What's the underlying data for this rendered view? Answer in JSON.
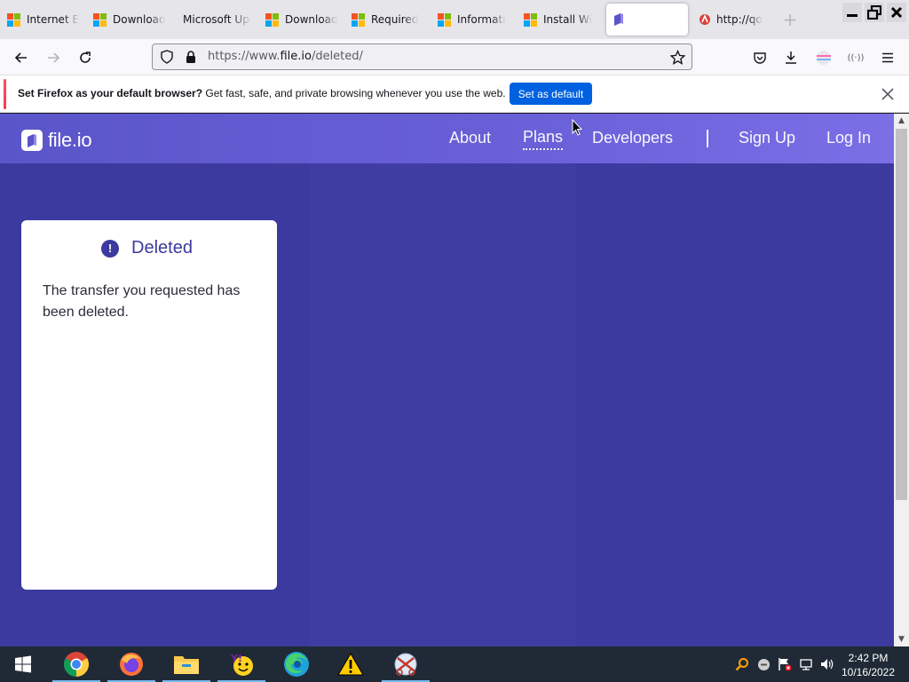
{
  "browser": {
    "tabs": [
      {
        "title": "Internet E",
        "favicon": "microsoft-icon",
        "active": false
      },
      {
        "title": "Download",
        "favicon": "microsoft-icon",
        "active": false
      },
      {
        "title": "Microsoft Upo",
        "favicon": "none",
        "active": false
      },
      {
        "title": "Download",
        "favicon": "microsoft-icon",
        "active": false
      },
      {
        "title": "Required",
        "favicon": "microsoft-icon",
        "active": false
      },
      {
        "title": "Informati",
        "favicon": "microsoft-icon",
        "active": false
      },
      {
        "title": "Install Wi",
        "favicon": "microsoft-icon",
        "active": false
      },
      {
        "title": "",
        "favicon": "fileio-icon",
        "active": true
      },
      {
        "title": "http://qo",
        "favicon": "http-icon",
        "active": false
      }
    ],
    "url_prefix": "https://www.",
    "url_domain": "file.io",
    "url_path": "/deleted/",
    "notification": {
      "bold": "Set Firefox as your default browser?",
      "text": " Get fast, safe, and private browsing whenever you use the web.",
      "button": "Set as default"
    }
  },
  "site": {
    "logo_text": "file.io",
    "nav": {
      "about": "About",
      "plans": "Plans",
      "developers": "Developers",
      "signup": "Sign Up",
      "login": "Log In"
    },
    "card": {
      "icon": "!",
      "title": "Deleted",
      "body": "The transfer you requested has been deleted."
    }
  },
  "taskbar": {
    "apps": [
      "windows-start-icon",
      "chrome-icon",
      "firefox-icon",
      "file-explorer-icon",
      "yahoo-messenger-icon",
      "edge-icon",
      "warning-icon",
      "snipping-tool-icon"
    ],
    "time": "2:42 PM",
    "date": "10/16/2022"
  },
  "colors": {
    "page_bg": "#3c3a9e",
    "header_gradient": "#5a55c9",
    "accent_blue": "#0061e0"
  }
}
